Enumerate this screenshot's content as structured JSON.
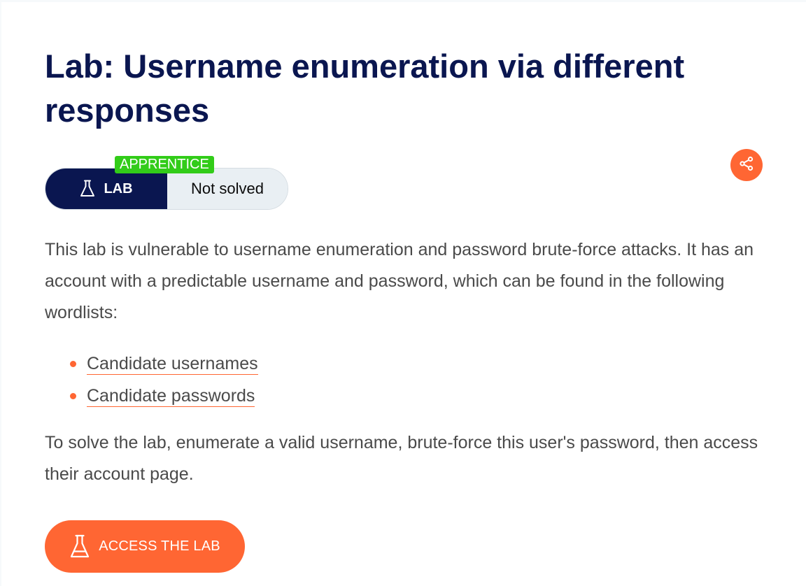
{
  "lab": {
    "title": "Lab: Username enumeration via different responses",
    "level": "APPRENTICE",
    "type_label": "LAB",
    "status": "Not solved"
  },
  "description": {
    "intro": "This lab is vulnerable to username enumeration and password brute-force attacks. It has an account with a predictable username and password, which can be found in the following wordlists:",
    "wordlists": [
      {
        "label": "Candidate usernames"
      },
      {
        "label": "Candidate passwords"
      }
    ],
    "goal": "To solve the lab, enumerate a valid username, brute-force this user's password, then access their account page."
  },
  "actions": {
    "access_label": "ACCESS THE LAB",
    "share_icon": "share-icon"
  },
  "icons": {
    "flask": "flask-icon",
    "bullet": "bullet-dot"
  },
  "colors": {
    "accent": "#ff6633",
    "navy": "#0a1650",
    "apprentice_green": "#32cc19",
    "status_bg": "#e9eff3",
    "body_text": "#4a4a4a"
  }
}
